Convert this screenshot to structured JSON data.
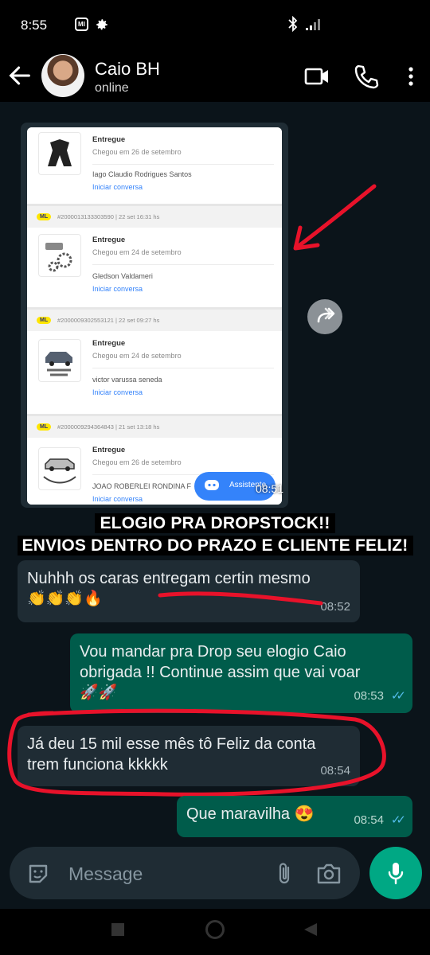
{
  "status_bar": {
    "time": "8:55",
    "mi_label": "MI"
  },
  "header": {
    "contact_name": "Caio BH",
    "contact_status": "online"
  },
  "forwarded_image": {
    "time": "08:51",
    "orders": [
      {
        "badge": "",
        "order_id": "",
        "status": "Entregue",
        "date": "Chegou em 26 de setembro",
        "buyer": "Iago Claudio Rodrigues Santos",
        "link": "Iniciar conversa"
      },
      {
        "badge": "ML",
        "order_id": "#2000013133303590 | 22 set 16:31 hs",
        "status": "Entregue",
        "date": "Chegou em 24 de setembro",
        "buyer": "Gledson Valdameri",
        "link": "Iniciar conversa"
      },
      {
        "badge": "ML",
        "order_id": "#2000009302553121 | 22 set 09:27 hs",
        "status": "Entregue",
        "date": "Chegou em 24 de setembro",
        "buyer": "victor varussa seneda",
        "link": "Iniciar conversa"
      },
      {
        "badge": "ML",
        "order_id": "#2000009294364843 | 21 set 13:18 hs",
        "status": "Entregue",
        "date": "Chegou em 26 de setembro",
        "buyer": "JOAO ROBERLEI RONDINA F",
        "link": "Iniciar conversa"
      }
    ],
    "assistant_label": "Assistente"
  },
  "caption": {
    "line1": "ELOGIO PRA DROPSTOCK!!",
    "line2": "ENVIOS DENTRO DO PRAZO E CLIENTE FELIZ!"
  },
  "messages": [
    {
      "direction": "in",
      "text": "Nuhhh os caras entregam certin mesmo",
      "emoji": "👏👏👏🔥",
      "time": "08:52"
    },
    {
      "direction": "out",
      "text_line1": "Vou mandar pra Drop seu elogio Caio",
      "text_line2": "obrigada !! Continue assim que vai voar",
      "emoji": "🚀🚀",
      "time": "08:53"
    },
    {
      "direction": "in",
      "text_line1": "Já deu 15 mil esse mês tô Feliz da conta",
      "text_line2": "trem funciona kkkkk",
      "time": "08:54"
    },
    {
      "direction": "out",
      "text": "Que maravilha 😍",
      "time": "08:54"
    }
  ],
  "composer": {
    "placeholder": "Message"
  },
  "colors": {
    "incoming": "#1f2c34",
    "outgoing": "#005c4b",
    "accent": "#00a884",
    "annotation": "#e8122a",
    "read_ticks": "#53bdeb"
  }
}
